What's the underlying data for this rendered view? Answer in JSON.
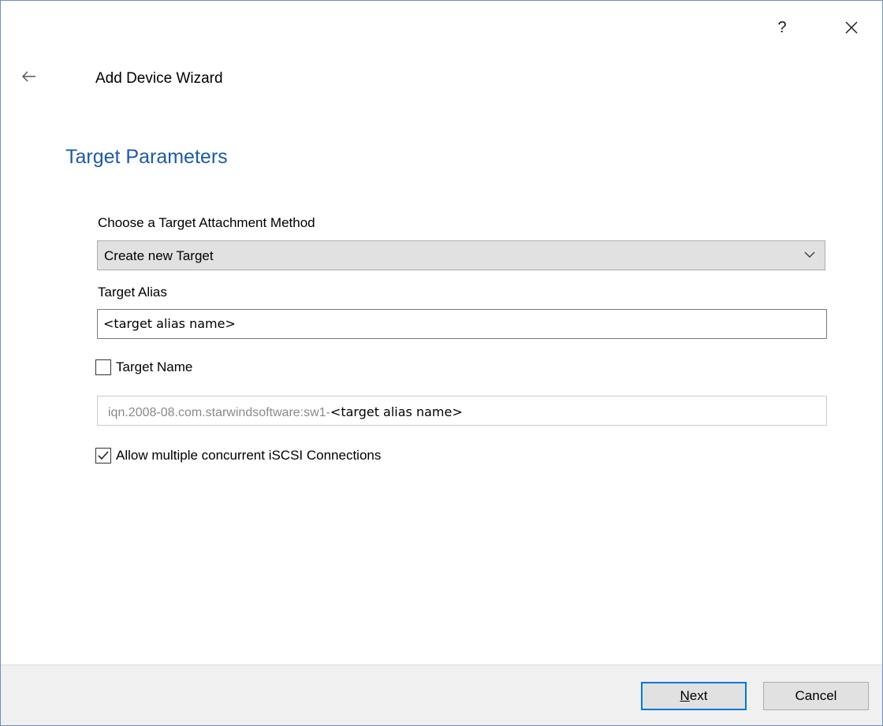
{
  "window": {
    "title": "Add Device Wizard",
    "help_label": "?"
  },
  "page": {
    "heading": "Target Parameters"
  },
  "attachment_method": {
    "label": "Choose a Target Attachment Method",
    "selected": "Create new Target"
  },
  "alias": {
    "label": "Target Alias",
    "value": "<target alias name>"
  },
  "target_name": {
    "label": "Target Name",
    "checked": false,
    "prefix": "iqn.2008-08.com.starwindsoftware:sw1-",
    "suffix": "<target alias name>"
  },
  "multi_connections": {
    "label": "Allow multiple concurrent iSCSI Connections",
    "checked": true
  },
  "footer": {
    "next_mnemonic": "N",
    "next_rest": "ext",
    "cancel_label": "Cancel"
  },
  "colors": {
    "heading": "#1e5aa8",
    "accent_border": "#0078d7",
    "window_border": "#6f8fbf"
  }
}
